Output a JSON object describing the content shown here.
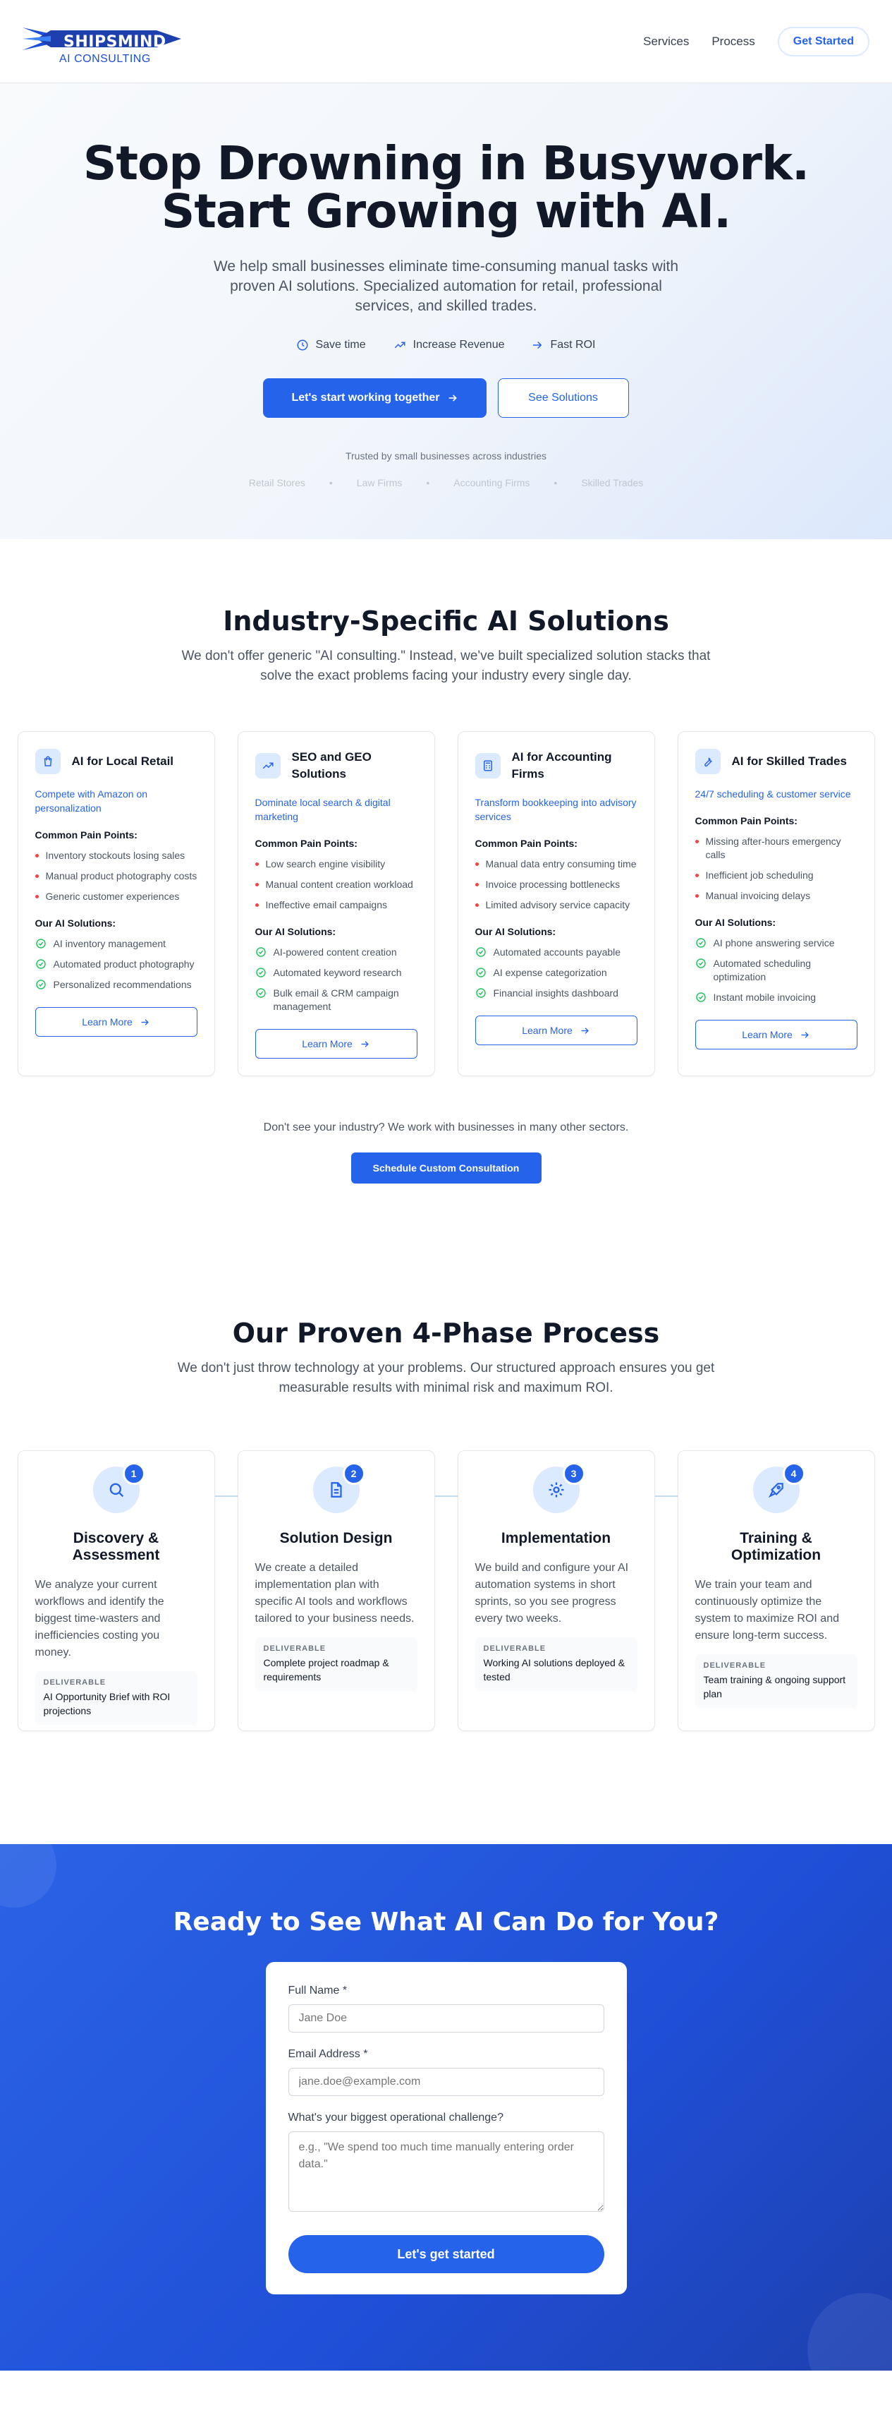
{
  "header": {
    "logo_name": "SHIPSMIND",
    "logo_sub": "AI CONSULTING",
    "nav": [
      "Services",
      "Process"
    ],
    "cta": "Get Started"
  },
  "hero": {
    "title_line1": "Stop Drowning in Busywork.",
    "title_line2": "Start Growing with AI.",
    "subtitle": "We help small businesses eliminate time-consuming manual tasks with proven AI solutions. Specialized automation for retail, professional services, and skilled trades.",
    "features": [
      {
        "label": "Save time",
        "icon": "clock-icon"
      },
      {
        "label": "Increase Revenue",
        "icon": "trending-up-icon"
      },
      {
        "label": "Fast ROI",
        "icon": "arrow-right-icon"
      }
    ],
    "primary_cta": "Let's start working together",
    "secondary_cta": "See Solutions",
    "trusted": "Trusted by small businesses across industries",
    "industries": [
      "Retail Stores",
      "Law Firms",
      "Accounting Firms",
      "Skilled Trades"
    ]
  },
  "industry": {
    "title": "Industry-Specific AI Solutions",
    "subtitle": "We don't offer generic \"AI consulting.\" Instead, we've built specialized solution stacks that solve the exact problems facing your industry every single day.",
    "pain_label": "Common Pain Points:",
    "solutions_label": "Our AI Solutions:",
    "learn_more": "Learn More",
    "cards": [
      {
        "title": "AI for Local Retail",
        "icon": "shopping-bag-icon",
        "tag": "Compete with Amazon on personalization",
        "pains": [
          "Inventory stockouts losing sales",
          "Manual product photography costs",
          "Generic customer experiences"
        ],
        "solutions": [
          "AI inventory management",
          "Automated product photography",
          "Personalized recommendations"
        ]
      },
      {
        "title": "SEO and GEO Solutions",
        "icon": "trending-up-icon",
        "tag": "Dominate local search & digital marketing",
        "pains": [
          "Low search engine visibility",
          "Manual content creation workload",
          "Ineffective email campaigns"
        ],
        "solutions": [
          "AI-powered content creation",
          "Automated keyword research",
          "Bulk email & CRM campaign management"
        ]
      },
      {
        "title": "AI for Accounting Firms",
        "icon": "calculator-icon",
        "tag": "Transform bookkeeping into advisory services",
        "pains": [
          "Manual data entry consuming time",
          "Invoice processing bottlenecks",
          "Limited advisory service capacity"
        ],
        "solutions": [
          "Automated accounts payable",
          "AI expense categorization",
          "Financial insights dashboard"
        ]
      },
      {
        "title": "AI for Skilled Trades",
        "icon": "wrench-icon",
        "tag": "24/7 scheduling & customer service",
        "pains": [
          "Missing after-hours emergency calls",
          "Inefficient job scheduling",
          "Manual invoicing delays"
        ],
        "solutions": [
          "AI phone answering service",
          "Automated scheduling optimization",
          "Instant mobile invoicing"
        ]
      }
    ],
    "other_text": "Don't see your industry? We work with businesses in many other sectors.",
    "consult_cta": "Schedule Custom Consultation"
  },
  "process": {
    "title": "Our Proven 4-Phase Process",
    "subtitle": "We don't just throw technology at your problems. Our structured approach ensures you get measurable results with minimal risk and maximum ROI.",
    "deliverable_label": "DELIVERABLE",
    "phases": [
      {
        "num": "1",
        "icon": "search-icon",
        "title": "Discovery & Assessment",
        "desc": "We analyze your current workflows and identify the biggest time-wasters and inefficiencies costing you money.",
        "deliverable": "AI Opportunity Brief with ROI projections"
      },
      {
        "num": "2",
        "icon": "document-icon",
        "title": "Solution Design",
        "desc": "We create a detailed implementation plan with specific AI tools and workflows tailored to your business needs.",
        "deliverable": "Complete project roadmap & requirements"
      },
      {
        "num": "3",
        "icon": "gear-icon",
        "title": "Implementation",
        "desc": "We build and configure your AI automation systems in short sprints, so you see progress every two weeks.",
        "deliverable": "Working AI solutions deployed & tested"
      },
      {
        "num": "4",
        "icon": "rocket-icon",
        "title": "Training & Optimization",
        "desc": "We train your team and continuously optimize the system to maximize ROI and ensure long-term success.",
        "deliverable": "Team training & ongoing support plan"
      }
    ]
  },
  "cta": {
    "title": "Ready to See What AI Can Do for You?",
    "name_label": "Full Name *",
    "name_placeholder": "Jane Doe",
    "email_label": "Email Address *",
    "email_placeholder": "jane.doe@example.com",
    "challenge_label": "What's your biggest operational challenge?",
    "challenge_placeholder": "e.g., \"We spend too much time manually entering order data.\"",
    "submit": "Let's get started"
  },
  "colors": {
    "brand": "#2563eb",
    "brand_dark": "#1d4ed8",
    "pain_bullet": "#ef4444",
    "check": "#22c55e"
  }
}
